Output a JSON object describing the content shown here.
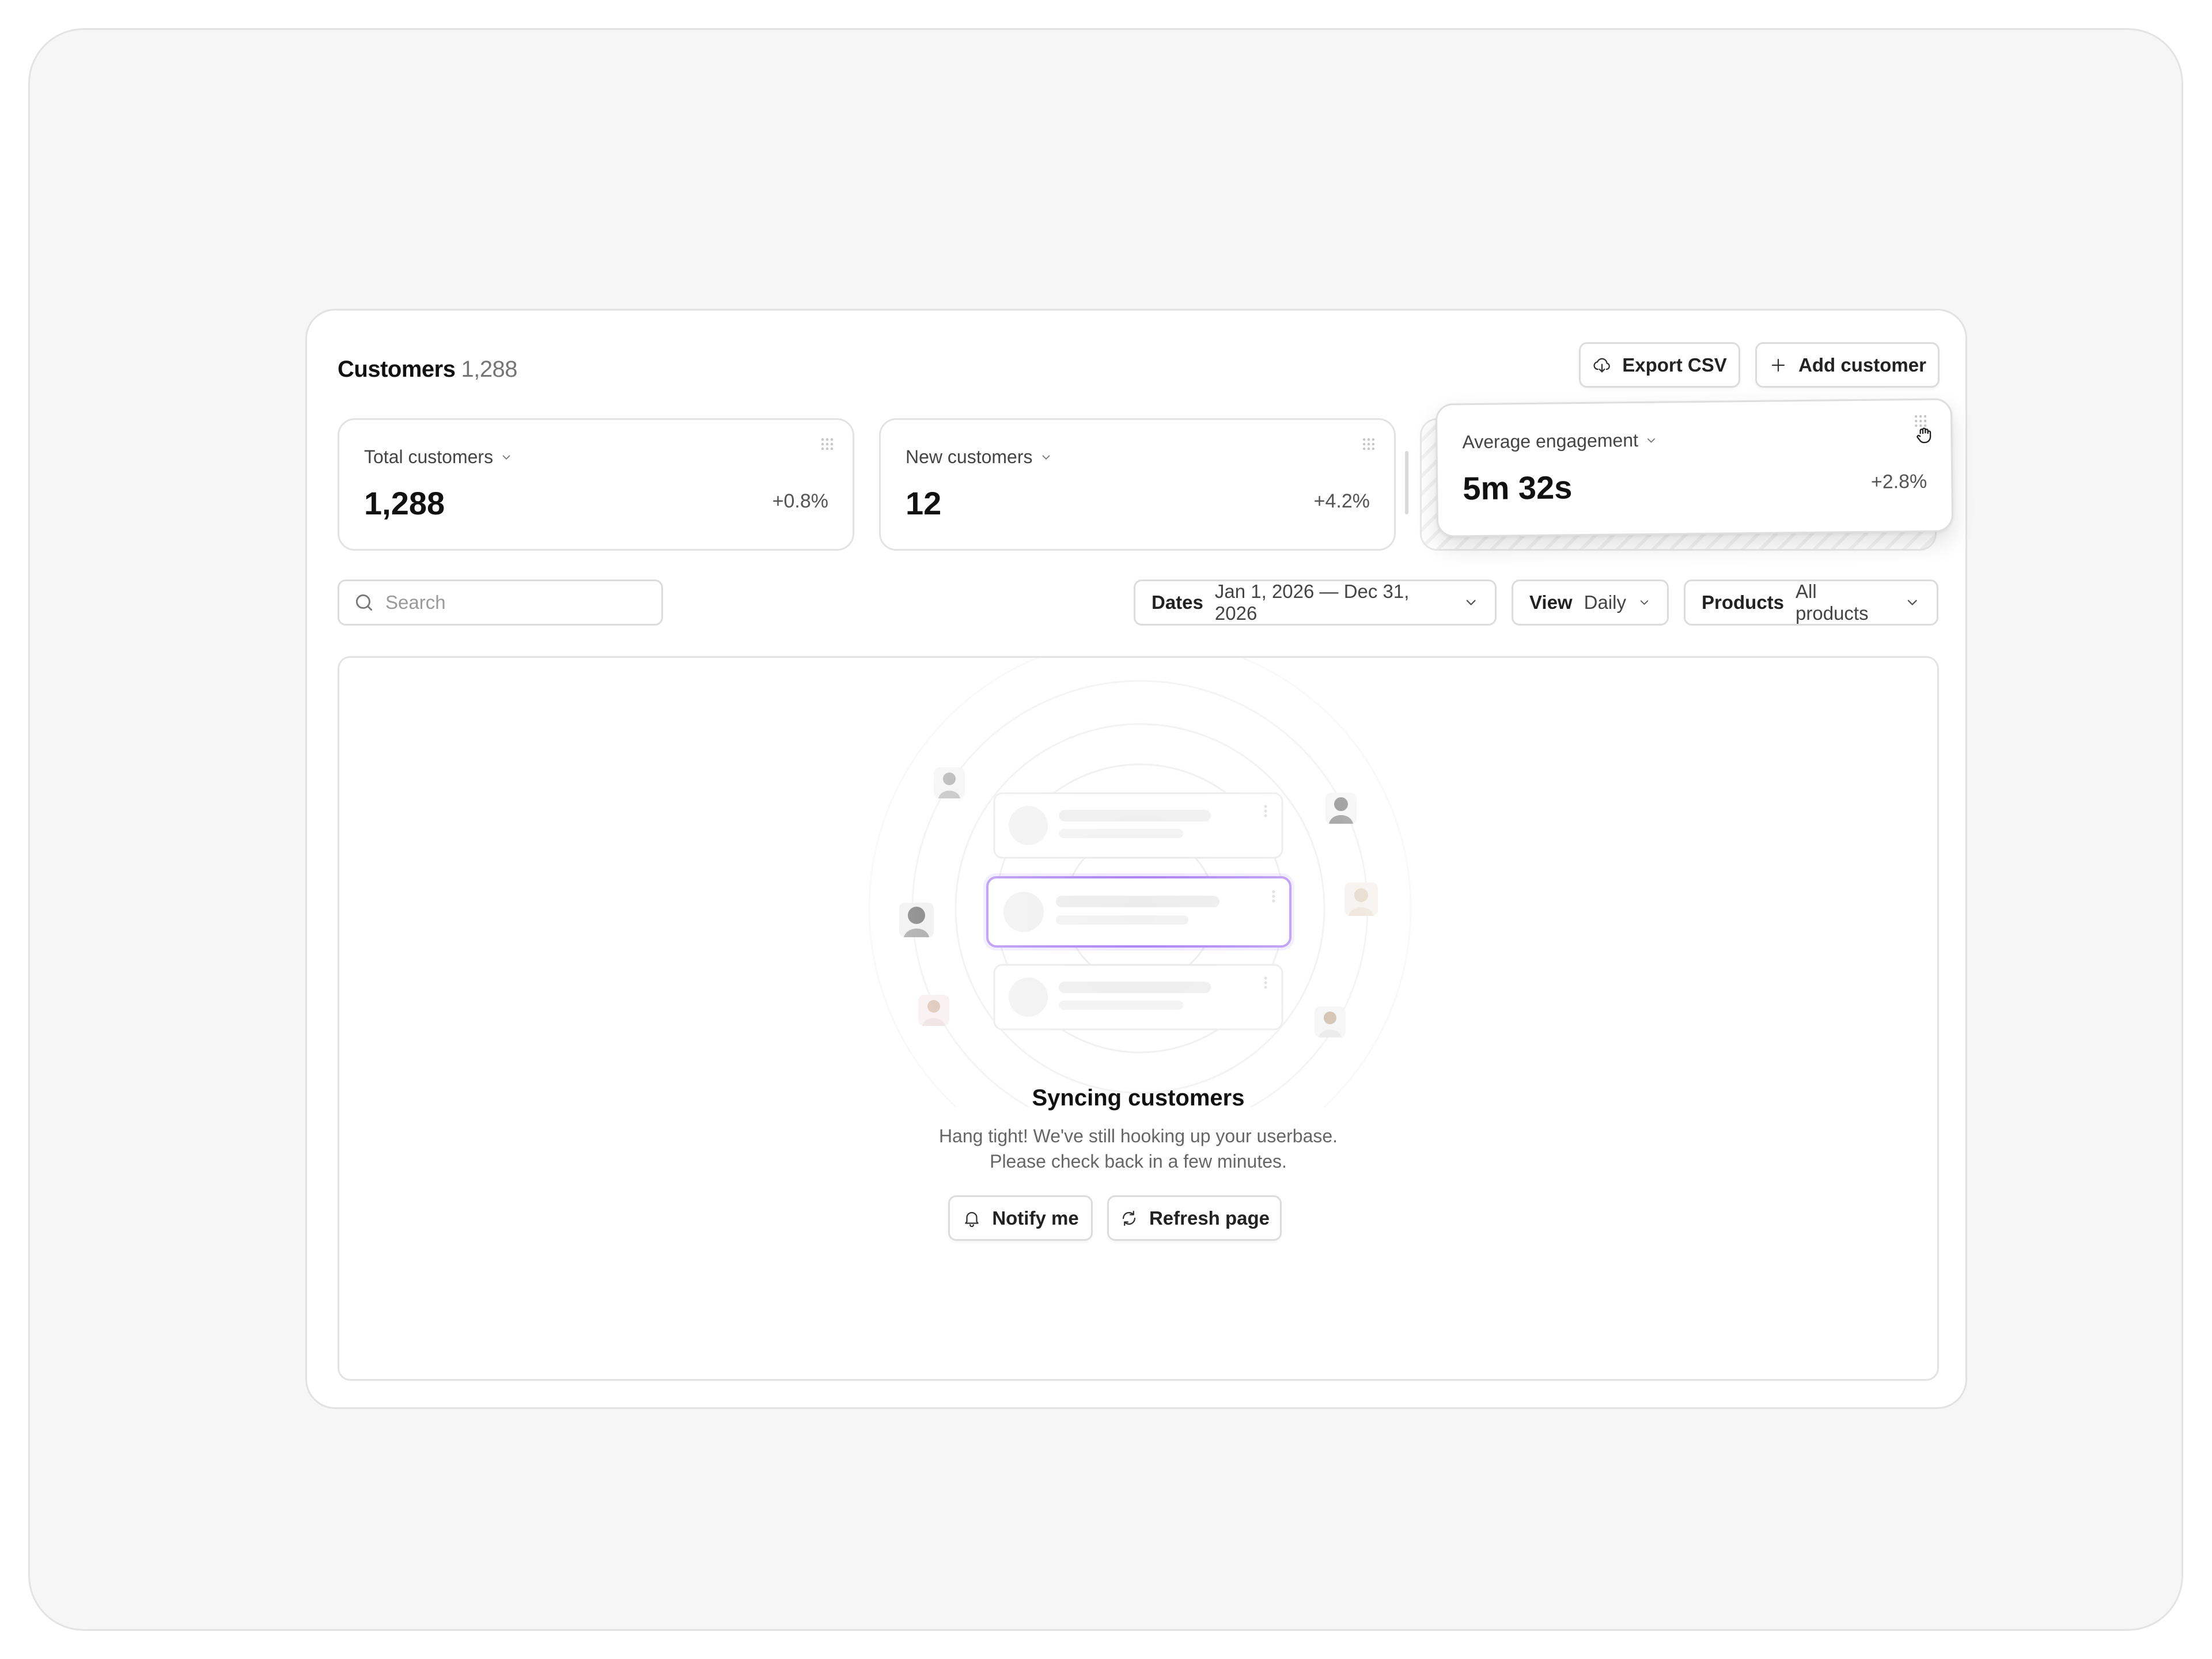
{
  "header": {
    "title": "Customers",
    "count": "1,288",
    "export_label": "Export CSV",
    "add_label": "Add customer"
  },
  "cards": [
    {
      "label": "Total customers",
      "value": "1,288",
      "delta": "+0.8%"
    },
    {
      "label": "New customers",
      "value": "12",
      "delta": "+4.2%"
    },
    {
      "label": "Average engagement",
      "value": "5m 32s",
      "delta": "+2.8%"
    }
  ],
  "search": {
    "placeholder": "Search"
  },
  "filters": {
    "dates": {
      "label": "Dates",
      "value": "Jan 1, 2026 — Dec 31, 2026"
    },
    "view": {
      "label": "View",
      "value": "Daily"
    },
    "products": {
      "label": "Products",
      "value": "All products"
    }
  },
  "empty_state": {
    "title": "Syncing customers",
    "line1": "Hang tight! We've still hooking up your userbase.",
    "line2": "Please check back in a few minutes.",
    "notify_label": "Notify me",
    "refresh_label": "Refresh page"
  },
  "colors": {
    "accent": "#a97ef5",
    "border": "#e2e2e2",
    "background": "#f6f6f6"
  },
  "icons": [
    "cloud-download-icon",
    "plus-icon",
    "grip-icon",
    "chevron-down-icon",
    "grab-cursor-icon",
    "search-icon",
    "bell-icon",
    "refresh-icon"
  ]
}
